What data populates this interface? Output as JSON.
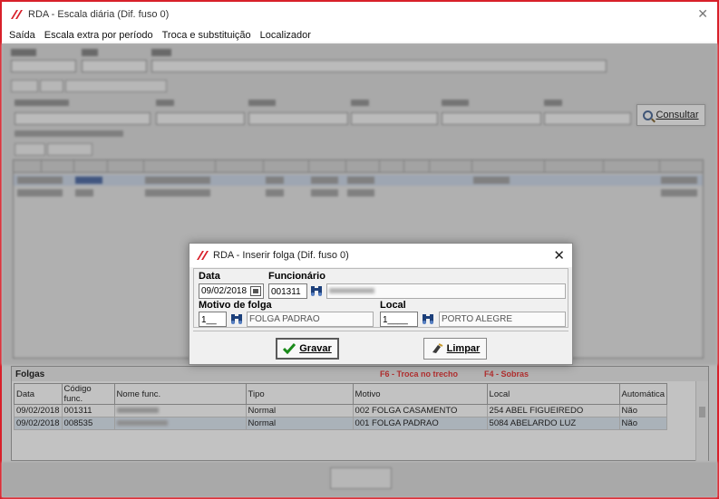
{
  "window": {
    "title": "RDA - Escala diária (Dif. fuso 0)",
    "close_glyph": "✕"
  },
  "menu": {
    "items": [
      "Saída",
      "Escala extra por período",
      "Troca e substituição",
      "Localizador"
    ]
  },
  "background": {
    "consultar_label": "Consultar"
  },
  "folgas": {
    "title": "Folgas",
    "hint_f6": "F6 - Troca no trecho",
    "hint_f4": "F4 - Sobras",
    "columns": [
      "Data",
      "Código func.",
      "Nome func.",
      "Tipo",
      "Motivo",
      "Local",
      "Automática"
    ],
    "rows": [
      {
        "data": "09/02/2018",
        "codigo": "001311",
        "nome": "",
        "tipo": "Normal",
        "motivo": "002 FOLGA CASAMENTO",
        "local": "254 ABEL FIGUEIREDO",
        "automatica": "Não"
      },
      {
        "data": "09/02/2018",
        "codigo": "008535",
        "nome": "",
        "tipo": "Normal",
        "motivo": "001 FOLGA PADRAO",
        "local": "5084 ABELARDO LUZ",
        "automatica": "Não"
      }
    ]
  },
  "dialog": {
    "title": "RDA - Inserir folga (Dif. fuso 0)",
    "close_glyph": "✕",
    "data_label": "Data",
    "data_value": "09/02/2018",
    "funcionario_label": "Funcionário",
    "funcionario_code": "001311",
    "funcionario_name": "",
    "motivo_label": "Motivo de folga",
    "motivo_code": "1__",
    "motivo_desc": "FOLGA PADRAO",
    "local_label": "Local",
    "local_code": "1____",
    "local_desc": "PORTO ALEGRE",
    "gravar_label": "Gravar",
    "limpar_label": "Limpar"
  },
  "colors": {
    "window_border": "#d8202a",
    "hint_red": "#e41c1c",
    "selected_row": "#dbe6f2"
  },
  "icons": [
    "app-logo-icon",
    "search-binoculars-icon",
    "calendar-icon",
    "check-icon",
    "eraser-icon",
    "magnifier-icon"
  ]
}
